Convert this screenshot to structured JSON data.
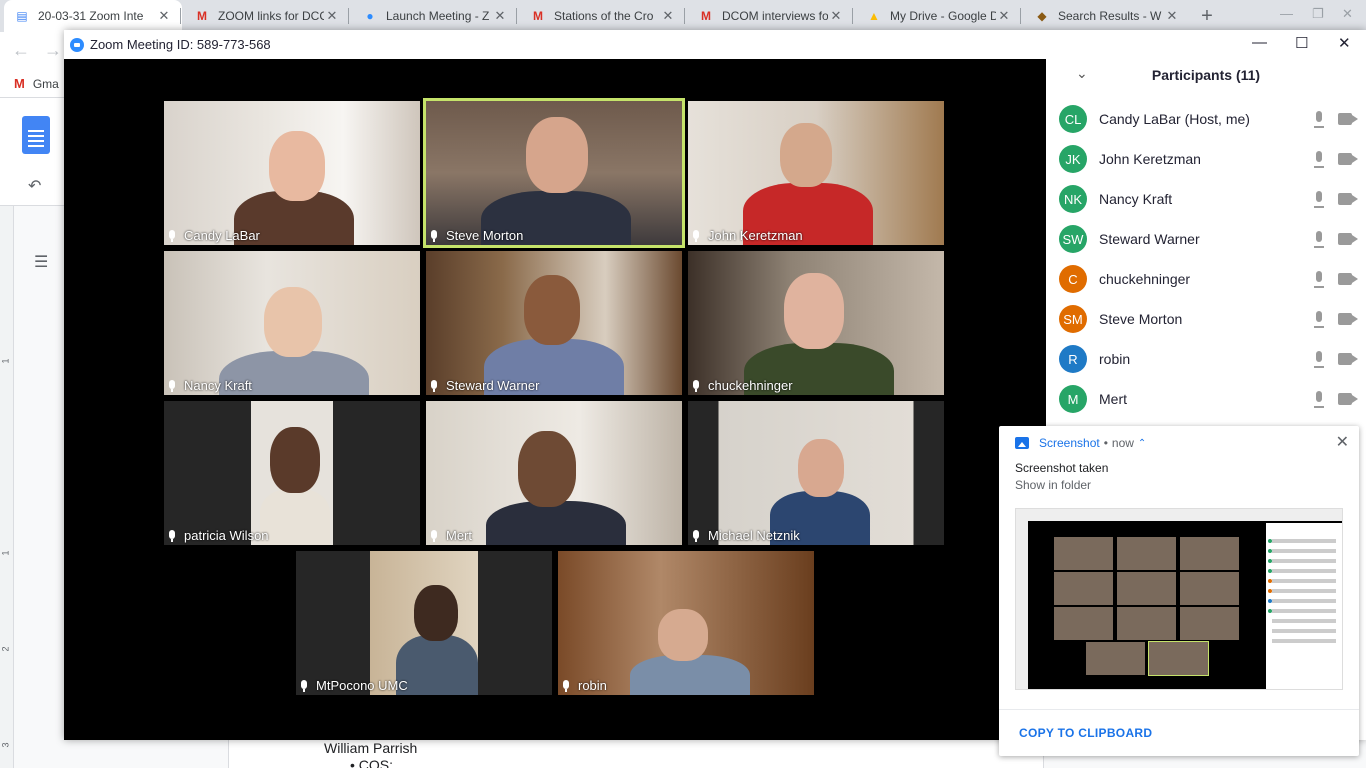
{
  "browser": {
    "tabs": [
      {
        "title": "20-03-31 Zoom Inte",
        "icon": "google-docs-icon",
        "color": "#4285f4"
      },
      {
        "title": "ZOOM links for DCC",
        "icon": "gmail-icon",
        "color": "#d93025"
      },
      {
        "title": "Launch Meeting - Z",
        "icon": "zoom-icon",
        "color": "#2d8cff"
      },
      {
        "title": "Stations of the Cro",
        "icon": "gmail-icon",
        "color": "#d93025"
      },
      {
        "title": "DCOM interviews fo",
        "icon": "gmail-icon",
        "color": "#d93025"
      },
      {
        "title": "My Drive - Google D",
        "icon": "google-drive-icon",
        "color": "#fbbc04"
      },
      {
        "title": "Search Results - W",
        "icon": "search-results-icon",
        "color": "#8a5a14"
      }
    ],
    "bookmark": "Gma"
  },
  "doc": {
    "line1": "William Parrish",
    "line2": "•    COS:",
    "ruler_marks": [
      "1",
      "1",
      "2",
      "3"
    ]
  },
  "zoom": {
    "title": "Zoom Meeting ID: 589-773-568",
    "accent": "#c5e36a",
    "tiles": [
      {
        "name": "Candy LaBar"
      },
      {
        "name": "Steve Morton"
      },
      {
        "name": "John Keretzman"
      },
      {
        "name": "Nancy Kraft"
      },
      {
        "name": "Steward Warner"
      },
      {
        "name": "chuckehninger"
      },
      {
        "name": "patricia Wilson"
      },
      {
        "name": "Mert"
      },
      {
        "name": "Michael Netznik"
      },
      {
        "name": "MtPocono UMC"
      },
      {
        "name": "robin"
      }
    ],
    "participants": {
      "title": "Participants (11)",
      "items": [
        {
          "initials": "CL",
          "name": "Candy LaBar (Host, me)",
          "color": "#27a567"
        },
        {
          "initials": "JK",
          "name": "John Keretzman",
          "color": "#27a567"
        },
        {
          "initials": "NK",
          "name": "Nancy Kraft",
          "color": "#27a567"
        },
        {
          "initials": "SW",
          "name": "Steward Warner",
          "color": "#27a567"
        },
        {
          "initials": "C",
          "name": "chuckehninger",
          "color": "#e06c00"
        },
        {
          "initials": "SM",
          "name": "Steve Morton",
          "color": "#e06c00"
        },
        {
          "initials": "R",
          "name": "robin",
          "color": "#1f7ac6"
        },
        {
          "initials": "M",
          "name": "Mert",
          "color": "#27a567"
        }
      ]
    }
  },
  "notification": {
    "app": "Screenshot",
    "separator": "•",
    "time": "now",
    "title": "Screenshot taken",
    "subtitle": "Show in folder",
    "action": "COPY TO CLIPBOARD"
  }
}
